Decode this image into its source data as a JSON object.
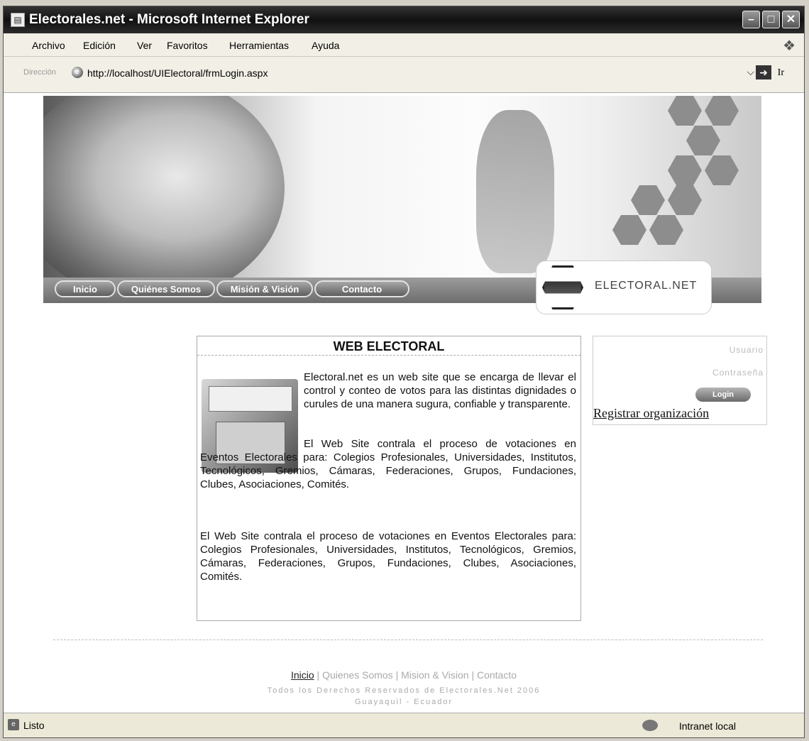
{
  "window": {
    "title": "Electorales.net - Microsoft Internet Explorer",
    "icon": "ie-page-icon",
    "controls": [
      "minimize",
      "maximize",
      "close"
    ]
  },
  "menu": {
    "items": [
      "Archivo",
      "Edición",
      "Ver",
      "Favoritos",
      "Herramientas",
      "Ayuda"
    ]
  },
  "address": {
    "label": "Dirección",
    "url": "http://localhost/UIElectoral/frmLogin.aspx",
    "go_label": "Ir"
  },
  "site": {
    "nav": [
      "Inicio",
      "Quiénes Somos",
      "Misión & Visión",
      "Contacto"
    ],
    "logo_text": "ELECTORAL.NET",
    "content": {
      "title": "WEB ELECTORAL",
      "paragraphs": [
        "Electoral.net es un web site que se encarga de llevar el control y conteo de votos para las distintas dignidades o curules de una manera sugura, confiable y transparente.",
        "El Web Site contrala el proceso de votaciones en Eventos Electorales para: Colegios Profesionales, Universidades, Institutos, Tecnológicos, Gremios, Cámaras, Federaciones, Grupos, Fundaciones, Clubes, Asociaciones, Comités.",
        "El Web Site contrala el proceso de votaciones en Eventos Electorales para: Colegios Profesionales, Universidades, Institutos, Tecnológicos, Gremios, Cámaras, Federaciones, Grupos, Fundaciones, Clubes, Asociaciones, Comités."
      ]
    },
    "login": {
      "user_label": "Usuario",
      "password_label": "Contraseña",
      "button": "Login",
      "register_link": "Registrar organización"
    },
    "footer": {
      "links": [
        "Inicio",
        "Quienes Somos",
        "Mision & Vision",
        "Contacto"
      ],
      "copyright": "Todos los Derechos Reservados de Electorales.Net 2006",
      "location": "Guayaquil - Ecuador"
    }
  },
  "status": {
    "text": "Listo",
    "zone": "Intranet local"
  }
}
